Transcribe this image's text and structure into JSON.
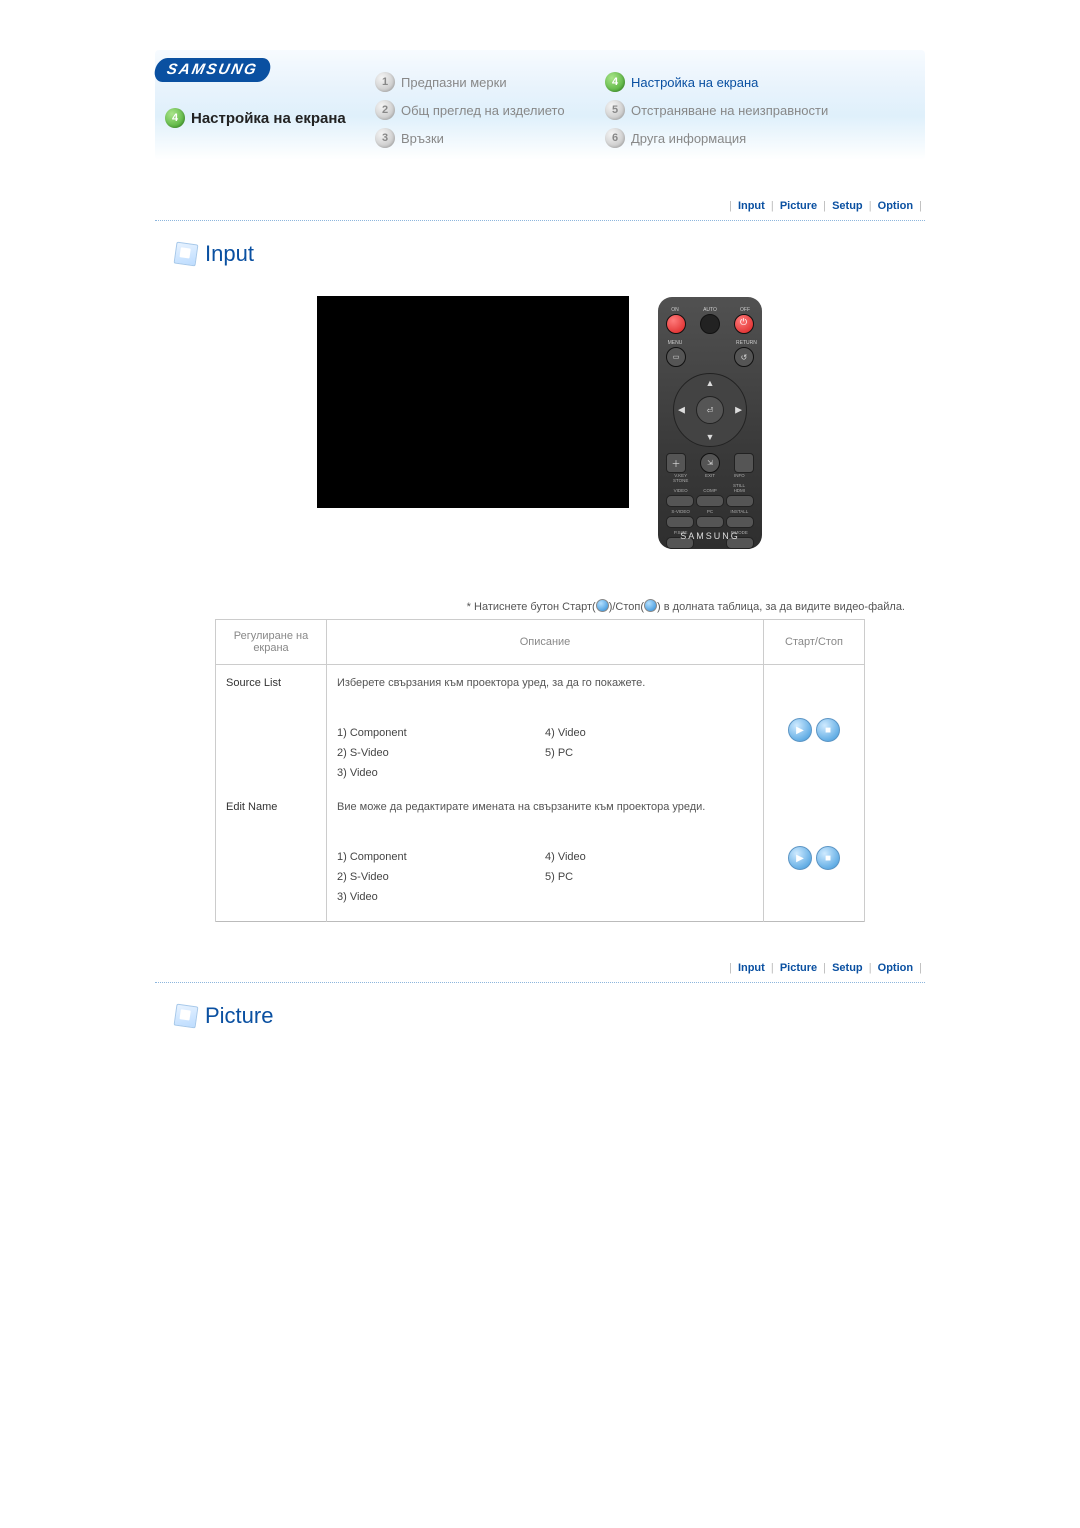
{
  "brand": "SAMSUNG",
  "active_section": {
    "number": "4",
    "title": "Настройка на екрана"
  },
  "nav": {
    "col1": [
      {
        "num": "1",
        "label": "Предпазни мерки",
        "active": false
      },
      {
        "num": "2",
        "label": "Общ преглед на изделието",
        "active": false
      },
      {
        "num": "3",
        "label": "Връзки",
        "active": false
      }
    ],
    "col2": [
      {
        "num": "4",
        "label": "Настройка на екрана",
        "active": true
      },
      {
        "num": "5",
        "label": "Отстраняване на неизправности",
        "active": false
      },
      {
        "num": "6",
        "label": "Друга информация",
        "active": false
      }
    ]
  },
  "subnav": [
    "Input",
    "Picture",
    "Setup",
    "Option"
  ],
  "sections": {
    "input_title": "Input",
    "picture_title": "Picture"
  },
  "remote": {
    "on": "ON",
    "off": "OFF",
    "auto": "AUTO",
    "menu": "MENU",
    "return": "RETURN",
    "info": "INFO",
    "exit": "EXIT",
    "vkey": "V.KEY\nSTONE",
    "still": "STILL",
    "r1": [
      "VIDEO",
      "COMP",
      "HDMI"
    ],
    "r2": [
      "S-VIDEO",
      "PC",
      "INSTALL"
    ],
    "r3": [
      "P.SIZE",
      "",
      "P.MODE"
    ],
    "brand": "SAMSUNG"
  },
  "instruction": {
    "prefix": "* Натиснете бутон Старт(",
    "mid": ")/Стоп(",
    "suffix": ") в долната таблица, за да видите видео-файла."
  },
  "table": {
    "headers": {
      "name": "Регулиране на екрана",
      "desc": "Описание",
      "ctrl": "Старт/Стоп"
    },
    "rows": [
      {
        "name": "Source List",
        "desc": "Изберете свързания към проектора уред, за да го покажете.",
        "listA": [
          "1) Component",
          "2) S-Video",
          "3) Video"
        ],
        "listB": [
          "4) Video",
          "5) PC"
        ]
      },
      {
        "name": "Edit Name",
        "desc": "Вие може да редактирате имената на свързаните към проектора уреди.",
        "listA": [
          "1) Component",
          "2) S-Video",
          "3) Video"
        ],
        "listB": [
          "4) Video",
          "5) PC"
        ]
      }
    ]
  }
}
